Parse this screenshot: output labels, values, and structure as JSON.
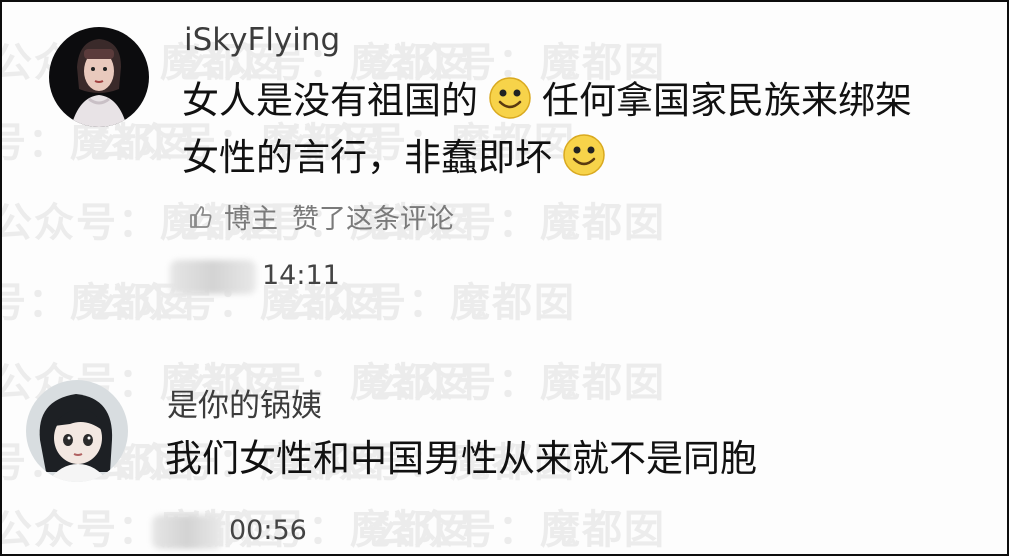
{
  "watermark": {
    "text": "公众号：魔都囡"
  },
  "comments": [
    {
      "username": "iSkyFlying",
      "text_line1_part1": "女人是没有祖国的",
      "text_line1_part2": "任何拿国家民族来绑架",
      "text_line2": "女性的言行，非蠢即坏",
      "liked_author": "博主",
      "liked_text": "赞了这条评论",
      "time": "14:11",
      "emoji_icon": "smiley-face-icon",
      "like_icon": "thumbs-up-icon"
    },
    {
      "username": "是你的锅姨",
      "text": "我们女性和中国男性从来就不是同胞",
      "time": "00:56"
    }
  ],
  "colors": {
    "username": "#3c3c3c",
    "comment_text": "#111111",
    "meta_text": "#7a7a7a",
    "watermark": "#ececec",
    "border": "#0d0d0d"
  }
}
